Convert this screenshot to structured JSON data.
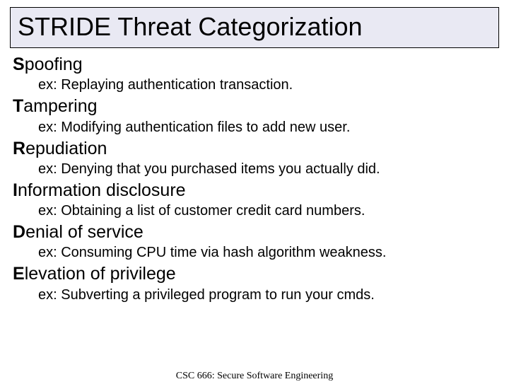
{
  "title": "STRIDE Threat Categorization",
  "threats": [
    {
      "lead": "S",
      "rest": "poofing",
      "example": "ex: Replaying authentication transaction."
    },
    {
      "lead": "T",
      "rest": "ampering",
      "example": "ex: Modifying authentication files to add new user."
    },
    {
      "lead": "R",
      "rest": "epudiation",
      "example": "ex: Denying that you purchased items you actually did."
    },
    {
      "lead": "I",
      "rest": "nformation disclosure",
      "example": "ex: Obtaining a list of customer credit card numbers."
    },
    {
      "lead": "D",
      "rest": "enial of service",
      "example": "ex: Consuming CPU time via hash algorithm weakness."
    },
    {
      "lead": "E",
      "rest": "levation of privilege",
      "example": "ex: Subverting a privileged program to run your cmds."
    }
  ],
  "footer": "CSC 666: Secure Software Engineering"
}
